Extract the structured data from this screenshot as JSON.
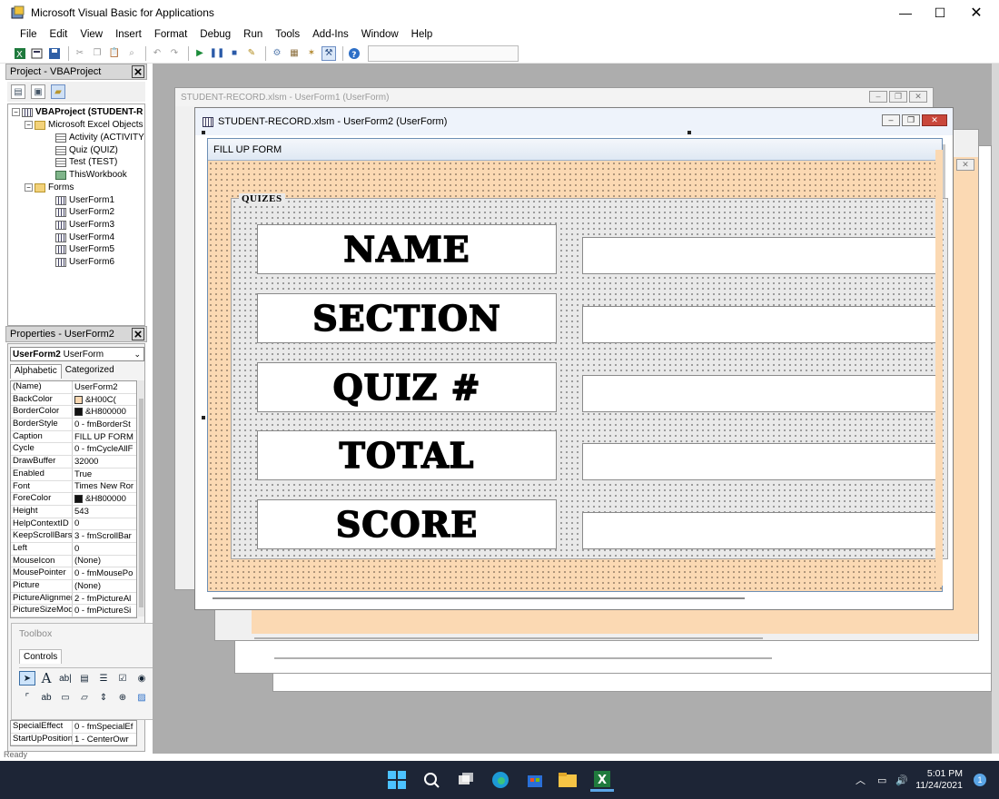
{
  "app": {
    "title": "Microsoft Visual Basic for Applications"
  },
  "menu": [
    "File",
    "Edit",
    "View",
    "Insert",
    "Format",
    "Debug",
    "Run",
    "Tools",
    "Add-Ins",
    "Window",
    "Help"
  ],
  "project": {
    "title": "Project - VBAProject",
    "tree": [
      {
        "label": "VBAProject (STUDENT-R",
        "icon": "project",
        "bold": true
      },
      {
        "label": "Microsoft Excel Objects",
        "icon": "folder"
      },
      {
        "label": "Activity (ACTIVITY)",
        "icon": "sheet"
      },
      {
        "label": "Quiz (QUIZ)",
        "icon": "sheet"
      },
      {
        "label": "Test (TEST)",
        "icon": "sheet"
      },
      {
        "label": "ThisWorkbook",
        "icon": "workbook"
      },
      {
        "label": "Forms",
        "icon": "folder"
      },
      {
        "label": "UserForm1",
        "icon": "form"
      },
      {
        "label": "UserForm2",
        "icon": "form"
      },
      {
        "label": "UserForm3",
        "icon": "form"
      },
      {
        "label": "UserForm4",
        "icon": "form"
      },
      {
        "label": "UserForm5",
        "icon": "form"
      },
      {
        "label": "UserForm6",
        "icon": "form"
      }
    ]
  },
  "properties": {
    "title": "Properties - UserForm2",
    "object_name": "UserForm2",
    "object_type": "UserForm",
    "tabs": [
      "Alphabetic",
      "Categorized"
    ],
    "rows": [
      {
        "name": "(Name)",
        "value": "UserForm2"
      },
      {
        "name": "BackColor",
        "value": "&H00C(",
        "swatch": "#fbd9b3"
      },
      {
        "name": "BorderColor",
        "value": "&H800000",
        "swatch": "#111111"
      },
      {
        "name": "BorderStyle",
        "value": "0 - fmBorderSt"
      },
      {
        "name": "Caption",
        "value": "FILL UP FORM"
      },
      {
        "name": "Cycle",
        "value": "0 - fmCycleAllF"
      },
      {
        "name": "DrawBuffer",
        "value": "32000"
      },
      {
        "name": "Enabled",
        "value": "True"
      },
      {
        "name": "Font",
        "value": "Times New Ror"
      },
      {
        "name": "ForeColor",
        "value": "&H800000",
        "swatch": "#111111"
      },
      {
        "name": "Height",
        "value": "543"
      },
      {
        "name": "HelpContextID",
        "value": "0"
      },
      {
        "name": "KeepScrollBarsV",
        "value": "3 - fmScrollBar"
      },
      {
        "name": "Left",
        "value": "0"
      },
      {
        "name": "MouseIcon",
        "value": "(None)"
      },
      {
        "name": "MousePointer",
        "value": "0 - fmMousePo"
      },
      {
        "name": "Picture",
        "value": "(None)"
      },
      {
        "name": "PictureAlignmen",
        "value": "2 - fmPictureAl"
      },
      {
        "name": "PictureSizeMode",
        "value": "0 - fmPictureSi"
      }
    ],
    "bottom_rows": [
      {
        "name": "SpecialEffect",
        "value": "0 - fmSpecialEf"
      },
      {
        "name": "StartUpPosition",
        "value": "1 - CenterOwr"
      }
    ]
  },
  "toolbox": {
    "title": "Toolbox",
    "tab": "Controls"
  },
  "windows": {
    "back_title": "STUDENT-RECORD.xlsm - UserForm1 (UserForm)",
    "front_title": "STUDENT-RECORD.xlsm - UserForm2 (UserForm)"
  },
  "form": {
    "caption": "FILL UP FORM",
    "frame_label": "QUIZES",
    "fields": [
      "NAME",
      "SECTION",
      "QUIZ #",
      "TOTAL",
      "SCORE"
    ]
  },
  "status": "Ready",
  "taskbar": {
    "time": "5:01 PM",
    "date": "11/24/2021",
    "notifications": "1"
  }
}
